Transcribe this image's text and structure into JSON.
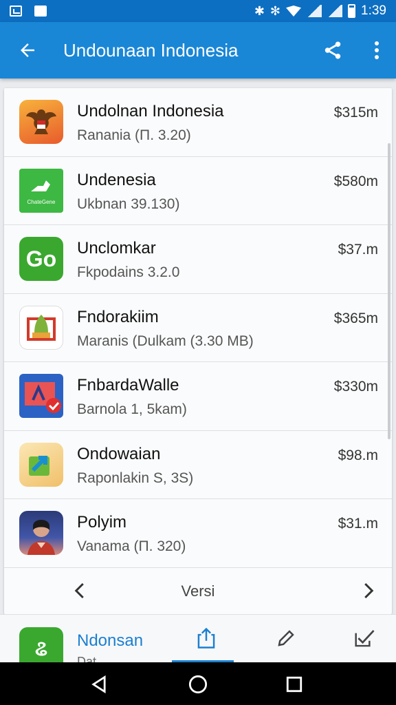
{
  "status_bar": {
    "time": "1:39",
    "bluetooth": "✱",
    "bluetooth2": "✻"
  },
  "app_bar": {
    "title": "Undounaan Indonesia"
  },
  "apps": [
    {
      "title": "Undolnan Indonesia",
      "subtitle": "Ranania (Π. 3.20)",
      "price": "$315m",
      "icon": "garuda-emblem-icon"
    },
    {
      "title": "Undenesia",
      "subtitle": "Ukbnan 39.130)",
      "price": "$580m",
      "icon": "green-app-icon",
      "icon_caption": "ChateGene"
    },
    {
      "title": "Unclomkar",
      "subtitle": "Fkpodains 3.2.0",
      "price": "$37.m",
      "icon": "go-app-icon",
      "icon_text": "Go"
    },
    {
      "title": "Fndorakiim",
      "subtitle": "Maranis (Dulkam (3.30 MB)",
      "price": "$365m",
      "icon": "folder-app-icon"
    },
    {
      "title": "FnbardaWalle",
      "subtitle": "Barnola 1, 5kam)",
      "price": "$330m",
      "icon": "blue-check-app-icon"
    },
    {
      "title": "Ondowaian",
      "subtitle": "Raponlakin S, 3S)",
      "price": "$98.m",
      "icon": "arrow-app-icon"
    },
    {
      "title": "Polyim",
      "subtitle": "Vanama (Π. 320)",
      "price": "$31.m",
      "icon": "photo-app-icon"
    }
  ],
  "pager": {
    "label": "Versi"
  },
  "toolbar": {
    "app_name": "Ndonsan",
    "app_sub": "Dat",
    "app_icon_text": "ଌ"
  },
  "colors": {
    "app_bar": "#1a86d6",
    "status_bar": "#0d6fc2",
    "accent": "#1b7fd0"
  }
}
